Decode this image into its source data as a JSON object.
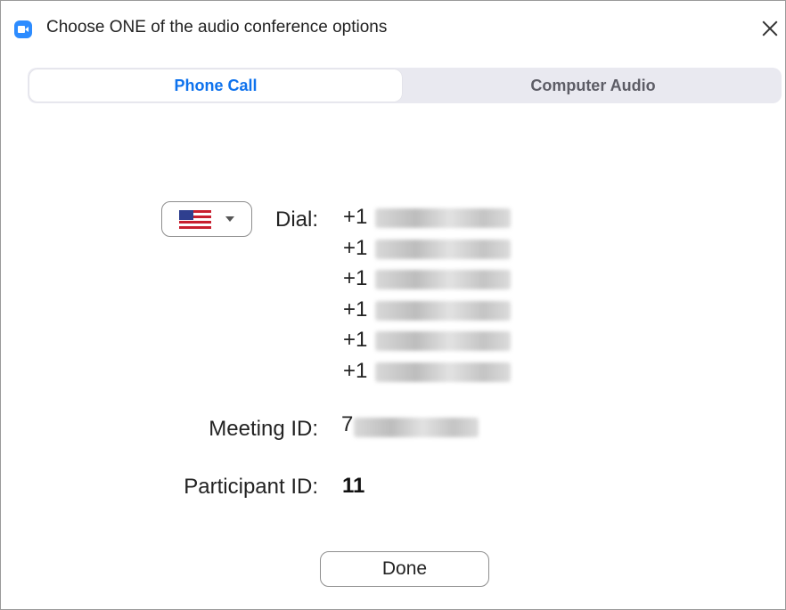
{
  "window": {
    "title": "Choose ONE of the audio conference options",
    "app_icon": "zoom-camera-icon",
    "close_icon": "close-icon"
  },
  "tabs": [
    {
      "label": "Phone Call",
      "active": true
    },
    {
      "label": "Computer Audio",
      "active": false
    }
  ],
  "country": {
    "flag": "us-flag-icon",
    "dropdown_icon": "chevron-down-icon"
  },
  "dial": {
    "label": "Dial:",
    "numbers": [
      {
        "prefix": "+1"
      },
      {
        "prefix": "+1"
      },
      {
        "prefix": "+1"
      },
      {
        "prefix": "+1"
      },
      {
        "prefix": "+1"
      },
      {
        "prefix": "+1"
      }
    ]
  },
  "meeting": {
    "label": "Meeting ID:",
    "value_visible": "7"
  },
  "participant": {
    "label": "Participant ID:",
    "value": "11"
  },
  "done_button": {
    "label": "Done"
  },
  "colors": {
    "accent": "#0e72ed",
    "brand_icon": "#2d8cff",
    "tab_bar": "#e9e9f0"
  }
}
